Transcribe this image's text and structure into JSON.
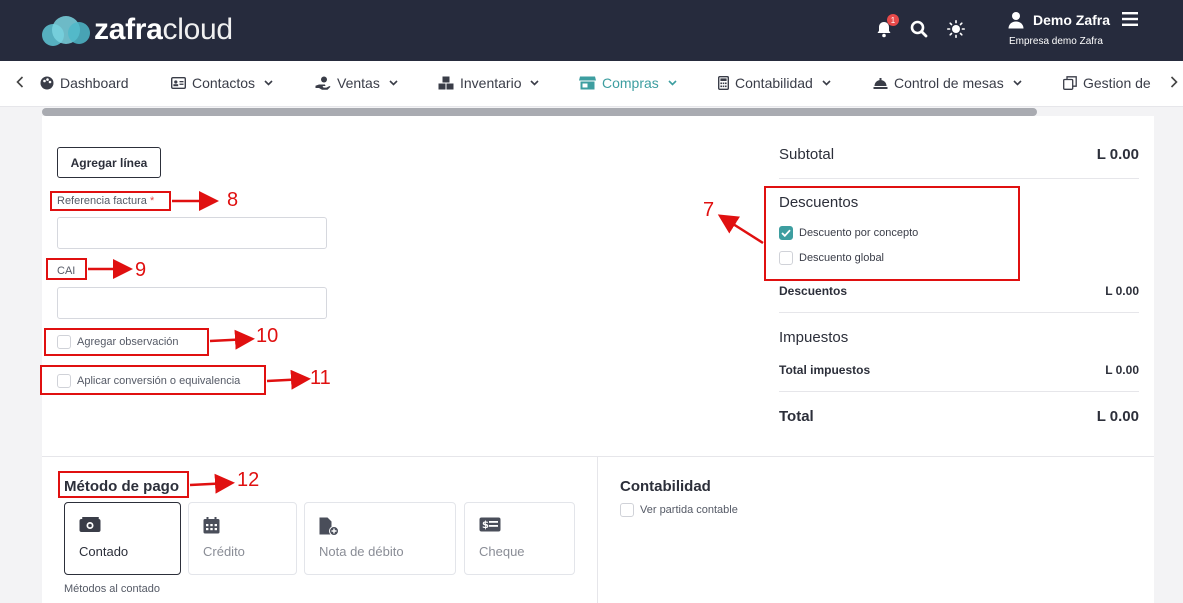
{
  "header": {
    "brand_bold": "zafra",
    "brand_light": "cloud",
    "notification_count": "1",
    "user_name": "Demo Zafra",
    "company": "Empresa demo Zafra"
  },
  "nav": {
    "items": [
      {
        "label": "Dashboard",
        "icon": "palette-icon"
      },
      {
        "label": "Contactos",
        "icon": "contact-card-icon"
      },
      {
        "label": "Ventas",
        "icon": "hand-dollar-icon"
      },
      {
        "label": "Inventario",
        "icon": "boxes-icon"
      },
      {
        "label": "Compras",
        "icon": "store-icon",
        "active": true
      },
      {
        "label": "Contabilidad",
        "icon": "calculator-icon"
      },
      {
        "label": "Control de mesas",
        "icon": "cloche-icon"
      },
      {
        "label": "Gestion de",
        "icon": "copy-icon"
      }
    ]
  },
  "form": {
    "add_line_label": "Agregar línea",
    "invoice_ref_label": "Referencia factura",
    "required_mark": "*",
    "cai_label": "CAI",
    "add_observation_label": "Agregar observación",
    "apply_conversion_label": "Aplicar conversión o equivalencia"
  },
  "annotations": {
    "n7": "7",
    "n8": "8",
    "n9": "9",
    "n10": "10",
    "n11": "11",
    "n12": "12"
  },
  "summary": {
    "subtotal_label": "Subtotal",
    "subtotal_value": "L 0.00",
    "discounts_title": "Descuentos",
    "discount_concept_label": "Descuento por concepto",
    "discount_concept_checked": true,
    "discount_global_label": "Descuento global",
    "discount_global_checked": false,
    "discounts_label": "Descuentos",
    "discounts_value": "L 0.00",
    "taxes_title": "Impuestos",
    "total_taxes_label": "Total impuestos",
    "total_taxes_value": "L 0.00",
    "total_label": "Total",
    "total_value": "L 0.00"
  },
  "payment": {
    "title": "Método de pago",
    "methods": [
      {
        "label": "Contado",
        "icon": "cash-icon",
        "selected": true
      },
      {
        "label": "Crédito",
        "icon": "calendar-icon",
        "selected": false
      },
      {
        "label": "Nota de débito",
        "icon": "file-plus-icon",
        "selected": false
      },
      {
        "label": "Cheque",
        "icon": "check-money-icon",
        "selected": false
      }
    ],
    "note": "Métodos al contado"
  },
  "accounting": {
    "title": "Contabilidad",
    "view_entry_label": "Ver partida contable"
  },
  "colors": {
    "header_bg": "#262b3d",
    "accent": "#3d9ea0",
    "annotation": "#e01010"
  }
}
